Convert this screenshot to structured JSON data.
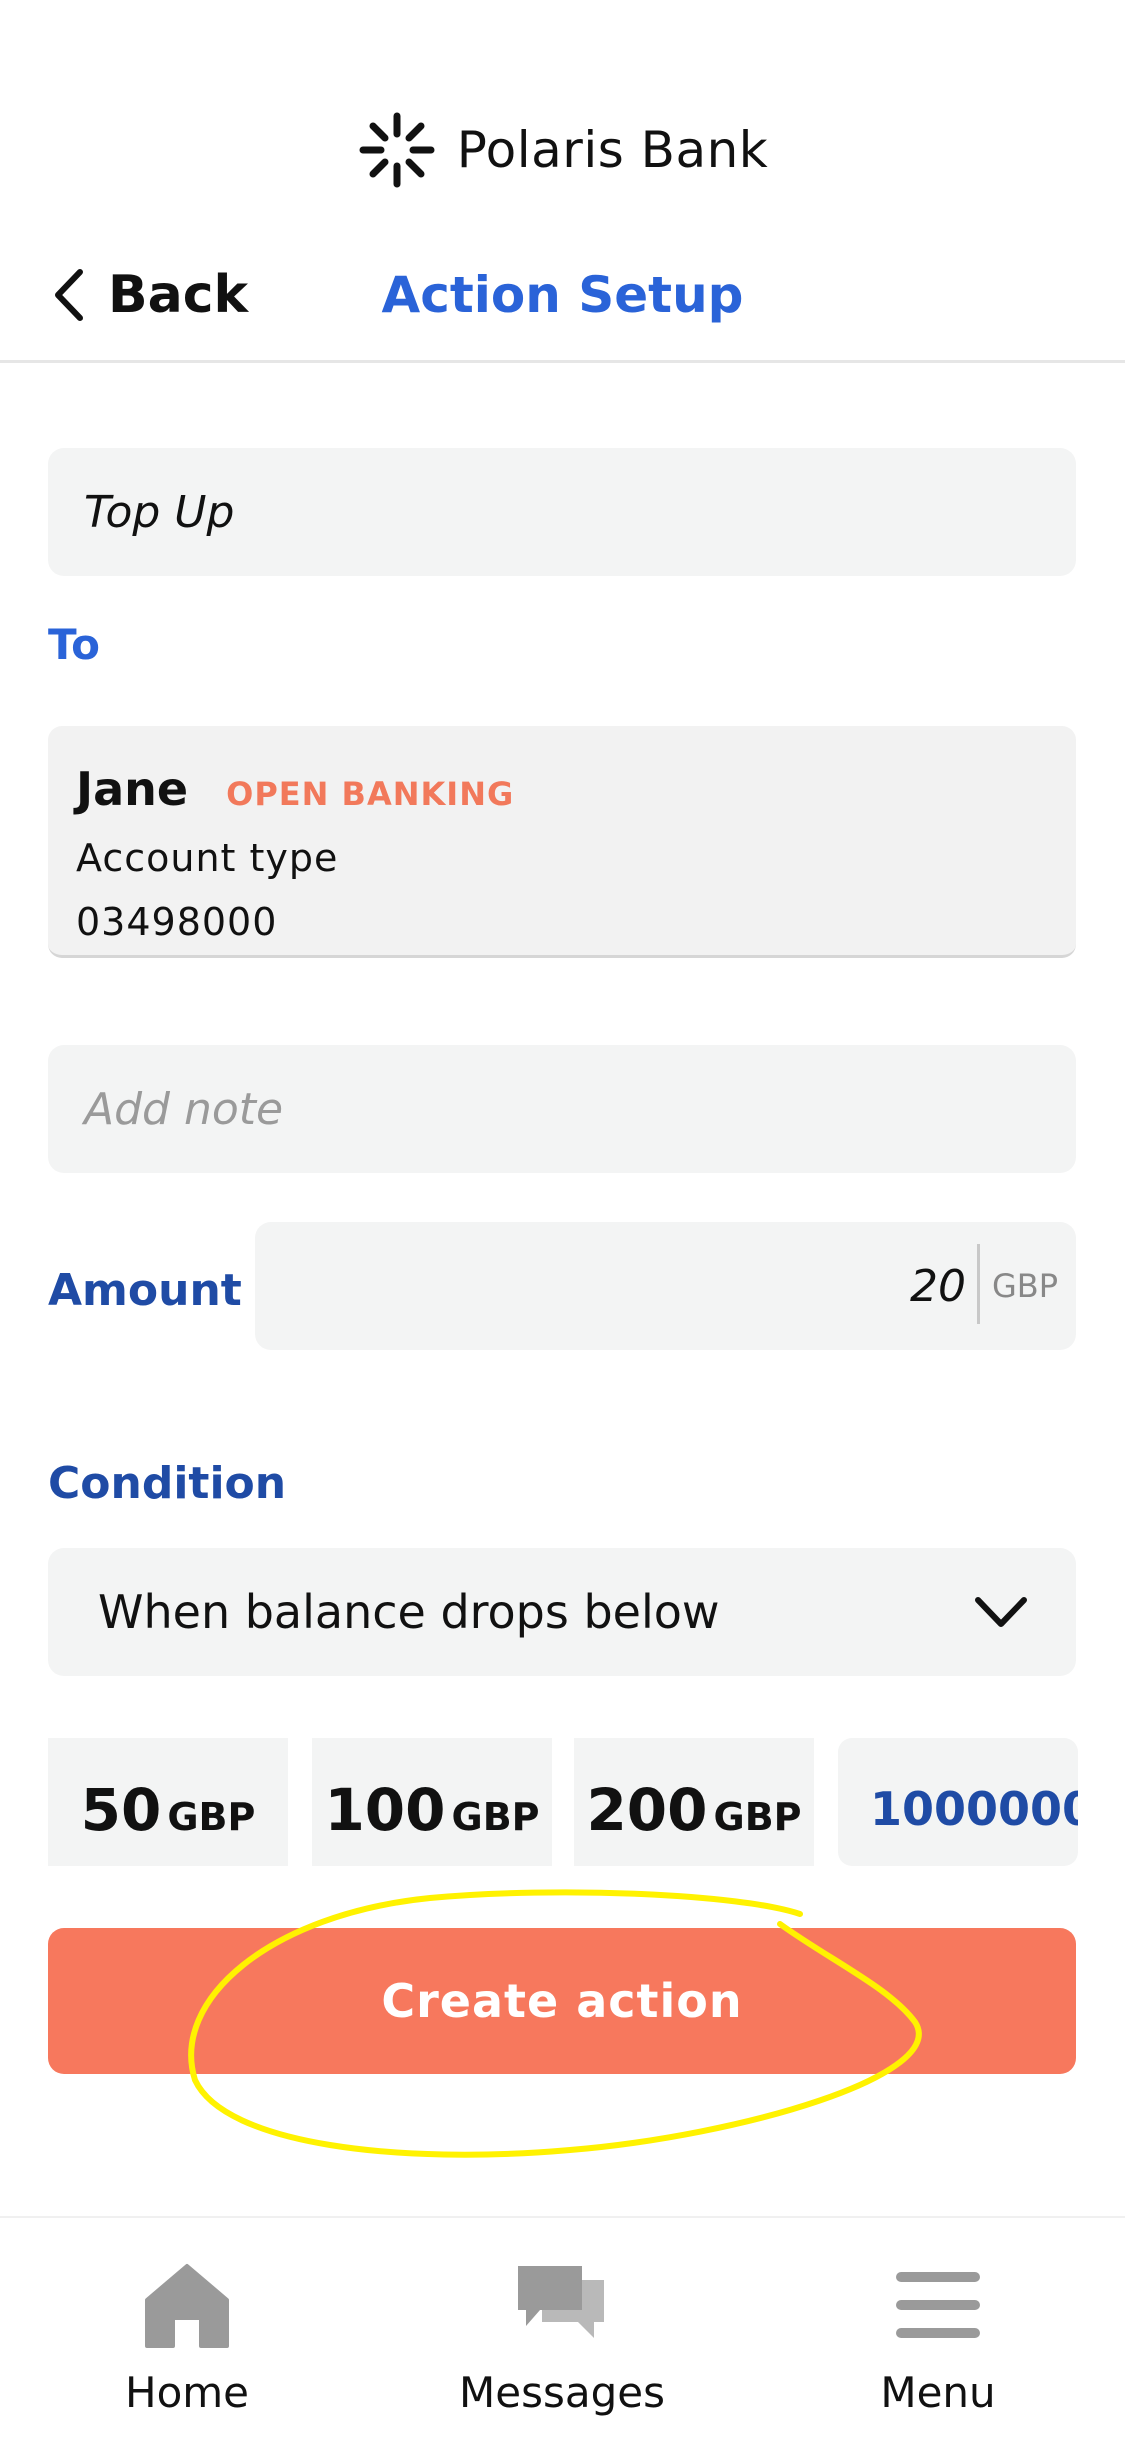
{
  "header": {
    "brand_name": "Polaris Bank",
    "back_label": "Back",
    "title": "Action Setup"
  },
  "form": {
    "action_name": "Top Up",
    "to_label": "To",
    "recipient": {
      "name": "Jane",
      "badge": "OPEN BANKING",
      "account_type": "Account type",
      "account_number": "03498000"
    },
    "note_placeholder": "Add note",
    "amount_label": "Amount",
    "amount_value": "20",
    "amount_currency": "GBP",
    "condition_label": "Condition",
    "condition_value": "When balance drops below",
    "threshold_chips": [
      {
        "value": "50",
        "currency": "GBP"
      },
      {
        "value": "100",
        "currency": "GBP"
      },
      {
        "value": "200",
        "currency": "GBP"
      }
    ],
    "custom_threshold": "1000000",
    "create_button": "Create action"
  },
  "tabbar": {
    "items": [
      {
        "label": "Home",
        "icon": "home-icon"
      },
      {
        "label": "Messages",
        "icon": "messages-icon"
      },
      {
        "label": "Menu",
        "icon": "menu-icon"
      }
    ]
  },
  "colors": {
    "accent_blue": "#2a63d8",
    "label_blue": "#1f4ba5",
    "primary_button": "#f7785d",
    "badge": "#f2795b",
    "annotation": "#fff200"
  }
}
